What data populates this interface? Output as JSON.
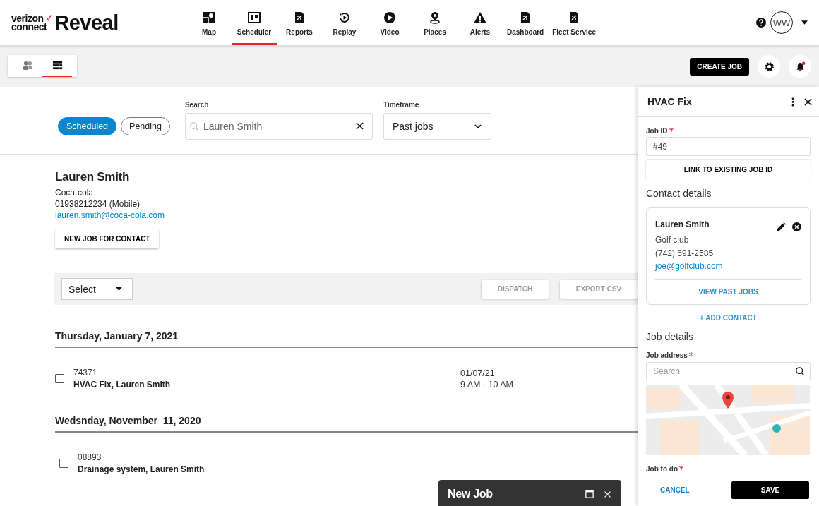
{
  "header": {
    "logo": {
      "line1": "verizon",
      "line2": "connect",
      "product": "Reveal"
    },
    "nav": [
      {
        "label": "Map",
        "kind": "map",
        "selected": false
      },
      {
        "label": "Scheduler",
        "kind": "scheduler",
        "selected": true
      },
      {
        "label": "Reports",
        "kind": "doc",
        "selected": false
      },
      {
        "label": "Replay",
        "kind": "replay",
        "selected": false
      },
      {
        "label": "Video",
        "kind": "video",
        "selected": false
      },
      {
        "label": "Places",
        "kind": "places",
        "selected": false
      },
      {
        "label": "Alerts",
        "kind": "alerts",
        "selected": false
      },
      {
        "label": "Dashboard",
        "kind": "doc",
        "selected": false
      },
      {
        "label": "Fleet Service",
        "kind": "doc",
        "selected": false
      }
    ],
    "user": {
      "initials": "WW"
    }
  },
  "toolbar": {
    "views": [
      {
        "kind": "contacts",
        "selected": false
      },
      {
        "kind": "list",
        "selected": true
      }
    ],
    "create_job": "CREATE JOB",
    "notifications_unread": true
  },
  "filters": {
    "statuses": [
      {
        "label": "Scheduled",
        "selected": true
      },
      {
        "label": "Pending",
        "selected": false
      }
    ],
    "search": {
      "label": "Search",
      "value": "Lauren Smith"
    },
    "timeframe": {
      "label": "Timeframe",
      "value": "Past jobs"
    }
  },
  "contact": {
    "name": "Lauren Smith",
    "company": "Coca-cola",
    "phone": "01938212234 (Mobile)",
    "email": "lauren.smith@coca-cola.com",
    "new_job": "NEW JOB FOR CONTACT"
  },
  "actions": {
    "select": "Select",
    "buttons": [
      {
        "label": "DISPATCH",
        "disabled": true
      },
      {
        "label": "EXPORT CSV",
        "disabled": true
      }
    ]
  },
  "job_groups": [
    {
      "date": "Thursday, January 7, 2021",
      "jobs": [
        {
          "id": "74371",
          "title": "HVAC Fix, Lauren Smith",
          "date": "01/07/21",
          "time": "9 AM - 10 AM",
          "checked": false
        }
      ]
    },
    {
      "date": "Wedsnday, November  11, 2020",
      "jobs": [
        {
          "id": "08893",
          "title": "Drainage system, Lauren Smith",
          "checked": false
        }
      ]
    }
  ],
  "panel": {
    "title": "HVAC Fix",
    "job_id": {
      "label": "Job ID",
      "required": true,
      "value": "#49"
    },
    "link_button": "LINK TO EXISTING JOB ID",
    "contact_heading": "Contact details",
    "contact_card": {
      "name": "Lauren Smith",
      "company": "Golf club",
      "phone": "(742) 691-2585",
      "email": "joe@golfclub.com",
      "view_jobs": "VIEW PAST JOBS"
    },
    "add_contact": "+ ADD CONTACT",
    "job_heading": "Job details",
    "address": {
      "label": "Job address",
      "required": true,
      "placeholder": "Search"
    },
    "job_to_do": {
      "label": "Job to do",
      "required": true
    },
    "cancel": "CANCEL",
    "save": "SAVE"
  },
  "new_job_popup": {
    "title": "New Job"
  }
}
